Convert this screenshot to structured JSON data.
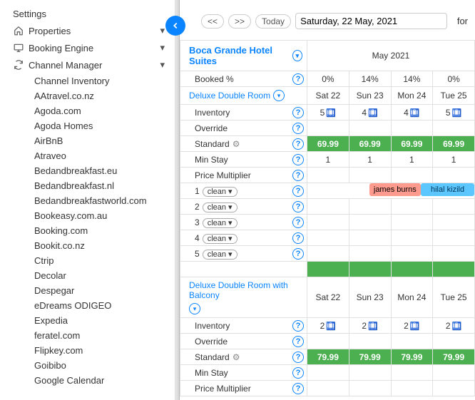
{
  "sidebar": {
    "items": [
      {
        "label": "Settings",
        "icon": null,
        "caret": false
      },
      {
        "label": "Properties",
        "icon": "home",
        "caret": true
      },
      {
        "label": "Booking Engine",
        "icon": "monitor",
        "caret": true
      },
      {
        "label": "Channel Manager",
        "icon": "sync",
        "caret": true
      }
    ],
    "channels": [
      "Channel Inventory",
      "AAtravel.co.nz",
      "Agoda.com",
      "Agoda Homes",
      "AirBnB",
      "Atraveo",
      "Bedandbreakfast.eu",
      "Bedandbreakfast.nl",
      "Bedandbreakfastworld.com",
      "Bookeasy.com.au",
      "Booking.com",
      "Bookit.co.nz",
      "Ctrip",
      "Decolar",
      "Despegar",
      "eDreams ODIGEO",
      "Expedia",
      "feratel.com",
      "Flipkey.com",
      "Goibibo",
      "Google Calendar"
    ]
  },
  "toolbar": {
    "prev": "<<",
    "next": ">>",
    "today": "Today",
    "date": "Saturday, 22 May, 2021",
    "for": "for"
  },
  "calendar": {
    "hotel_name": "Boca Grande Hotel Suites",
    "month_label": "May 2021",
    "booked_label": "Booked %",
    "booked_pct": [
      "0%",
      "14%",
      "14%",
      "0%"
    ],
    "days": [
      "Sat 22",
      "Sun 23",
      "Mon 24",
      "Tue 25"
    ],
    "rooms": [
      {
        "name": "Deluxe Double Room",
        "rows": {
          "inventory_label": "Inventory",
          "inventory": [
            "5",
            "4",
            "4",
            "5"
          ],
          "override_label": "Override",
          "rate_label": "Standard",
          "rate": [
            "69.99",
            "69.99",
            "69.99",
            "69.99"
          ],
          "minstay_label": "Min Stay",
          "minstay": [
            "1",
            "1",
            "1",
            "1"
          ],
          "pricex_label": "Price Multiplier",
          "units": [
            "1",
            "2",
            "3",
            "4",
            "5"
          ],
          "clean_label": "clean ▾",
          "bookings": [
            {
              "name": "james burns",
              "class": "book-red",
              "left_pct": 37,
              "width_pct": 31
            },
            {
              "name": "hilal kizild",
              "class": "book-blue",
              "left_pct": 68,
              "width_pct": 32
            }
          ]
        }
      },
      {
        "name": "Deluxe Double Room with Balcony",
        "rows": {
          "inventory_label": "Inventory",
          "inventory": [
            "2",
            "2",
            "2",
            "2"
          ],
          "override_label": "Override",
          "rate_label": "Standard",
          "rate": [
            "79.99",
            "79.99",
            "79.99",
            "79.99"
          ],
          "minstay_label": "Min Stay",
          "pricex_label": "Price Multiplier"
        }
      }
    ]
  },
  "icons": {
    "help": "?"
  }
}
